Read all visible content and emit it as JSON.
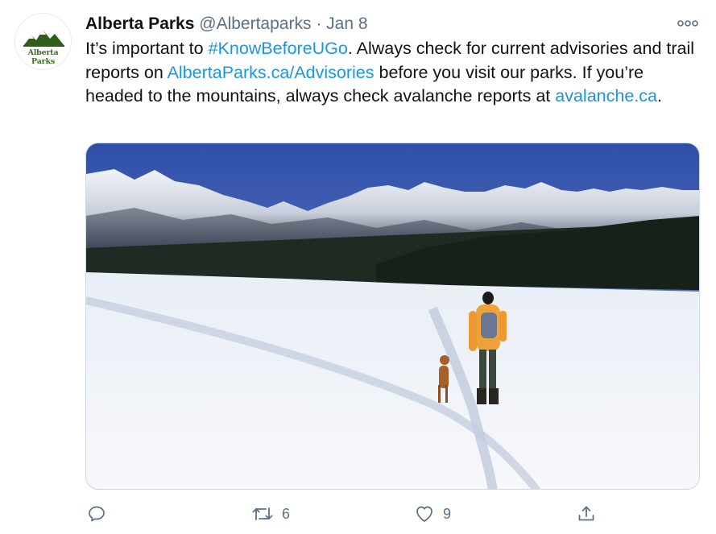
{
  "tweet": {
    "author_name": "Alberta Parks",
    "author_handle": "@Albertaparks",
    "separator": "·",
    "date": "Jan 8",
    "avatar_text": "Alberta Parks",
    "text": {
      "part1": "It’s important to ",
      "hashtag": "#KnowBeforeUGo",
      "part2": ". Always check for current advisories and trail reports on ",
      "link1": "AlbertaParks.ca/Advisories",
      "part3": " before you visit our parks. If you’re headed to the mountains, always check avalanche reports at ",
      "link2": "avalanche.ca",
      "part4": "."
    },
    "media_description_icon": "photo-snowy-mountain-lake-hiker-dog"
  },
  "actions": {
    "reply": {
      "icon": "reply-icon",
      "count": ""
    },
    "retweet": {
      "icon": "retweet-icon",
      "count": "6"
    },
    "like": {
      "icon": "heart-icon",
      "count": "9"
    },
    "share": {
      "icon": "share-icon",
      "count": ""
    }
  },
  "colors": {
    "link": "#1b95e0",
    "secondary": "#5b7083",
    "primary_text": "#0f1419",
    "logo_green": "#3a6b1e"
  }
}
